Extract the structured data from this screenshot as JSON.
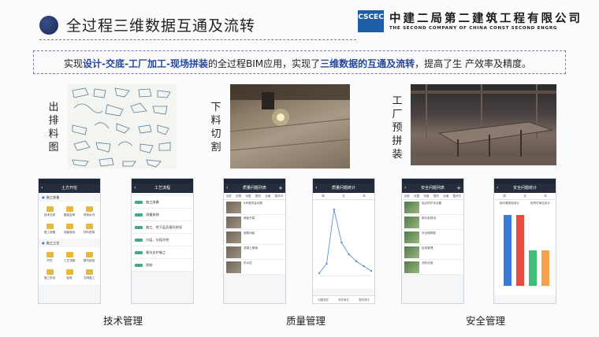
{
  "header": {
    "title": "全过程三维数据互通及流转",
    "company_cn": "中建二局第二建筑工程有限公司",
    "company_en": "THE SECOND COMPANY OF CHINA CONST SECOND ENGRG",
    "logo_text": "CSCEC"
  },
  "banner": {
    "pre": "实现",
    "highlight1": "设计-交底-工厂加工-现场拼装",
    "mid": "的全过程BIM应用，实现了",
    "highlight2": "三维数据的互通及流转",
    "post": "，提高了生 产效率及精度。"
  },
  "stages": [
    {
      "label": "出排料图"
    },
    {
      "label": "下料切割"
    },
    {
      "label": "工厂预拼装"
    }
  ],
  "captions": {
    "tech": "技术管理",
    "quality": "质量管理",
    "safety": "安全管理"
  },
  "phones": {
    "tech1": {
      "title": "土方开挖",
      "section1": "施工准备",
      "grid1": [
        "技术交底",
        "图纸会审",
        "现场水沟"
      ],
      "grid2": [
        "施工准备",
        "测量放线",
        "材料进场"
      ],
      "section2": "施工工艺",
      "grid3": [
        "开挖",
        "工艺流程",
        "基坑放线"
      ],
      "grid4": [
        "施工安全",
        "验收",
        "文明施工"
      ]
    },
    "tech2": {
      "title": "工艺流程",
      "rows": [
        "施工准备",
        "测量放线",
        "施工、挖下层及基坑挖深",
        "分层、分段开挖",
        "基坑支护施工",
        "验收"
      ]
    },
    "quality1": {
      "title": "质量问题列表",
      "tabs": [
        "全部",
        "待整",
        "待复",
        "整改",
        "合格",
        "整改中"
      ],
      "items": [
        "6号楼质量问题",
        "墙面开裂",
        "钢筋间距",
        "混凝土蜂窝",
        "防水层"
      ]
    },
    "quality2": {
      "title": "质量问题统计",
      "tabs": [
        "周",
        "月",
        "年"
      ],
      "foot": [
        "问题类型",
        "责任单位",
        "整改情况"
      ]
    },
    "safety1": {
      "title": "安全问题列表",
      "tabs": [
        "全部",
        "待整",
        "待复",
        "整改",
        "合格",
        "整改中"
      ],
      "items": [
        "临边防护未设置",
        "脚手架搭设",
        "安全帽佩戴",
        "临电管理",
        "消防设施"
      ]
    },
    "safety2": {
      "title": "安全问题统计",
      "tabs": [
        "周",
        "月",
        "年"
      ],
      "legend": [
        "按问题类型统计",
        "按责任单位统计"
      ]
    }
  },
  "chart_data": [
    {
      "type": "line",
      "values": [
        1,
        5,
        28,
        14,
        9,
        6,
        4,
        2
      ]
    },
    {
      "type": "bar",
      "values": [
        8,
        8,
        4,
        4
      ],
      "colors": [
        "#3a7bd5",
        "#e74c3c",
        "#3dbf7a",
        "#f5a04a"
      ]
    }
  ]
}
